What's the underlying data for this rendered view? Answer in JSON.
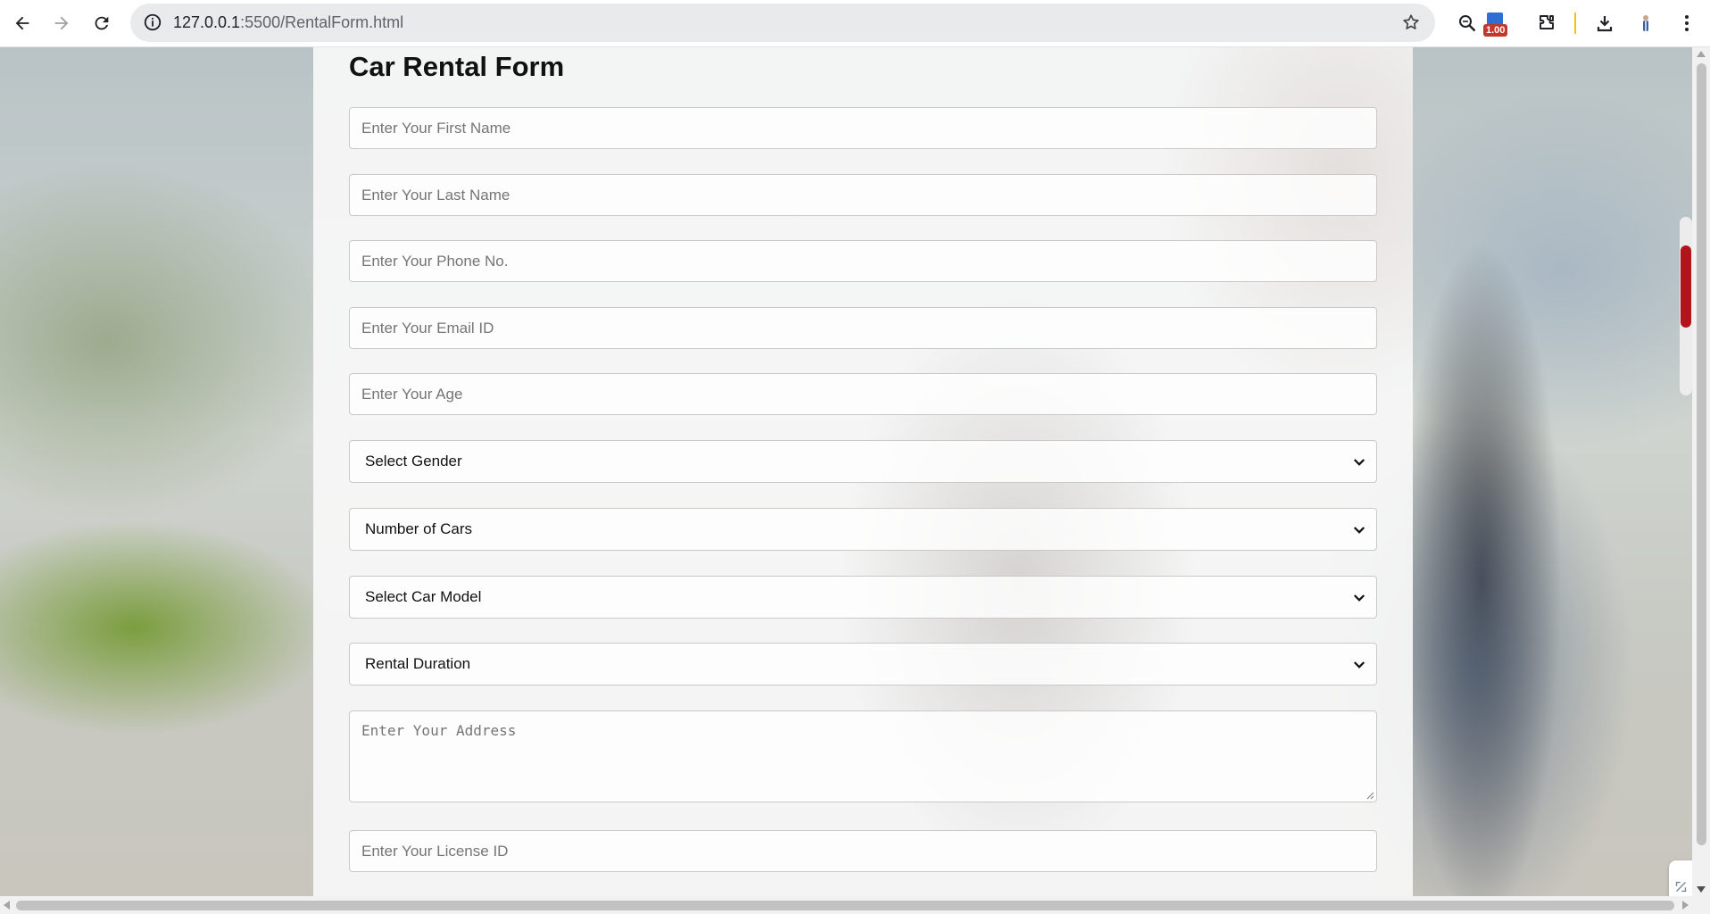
{
  "browser": {
    "url": "127.0.0.1:5500/RentalForm.html",
    "url_host": "127.0.0.1",
    "url_rest": ":5500/RentalForm.html",
    "extension_badge": "1.00",
    "icons": [
      "back-icon",
      "forward-icon",
      "reload-icon",
      "site-info-icon",
      "bookmark-star-icon",
      "zoom-icon",
      "extension-badge-icon",
      "puzzle-icon",
      "download-icon",
      "profile-icon",
      "menu-icon"
    ]
  },
  "form": {
    "title": "Car Rental Form",
    "first_name_placeholder": "Enter Your First Name",
    "last_name_placeholder": "Enter Your Last Name",
    "phone_placeholder": "Enter Your Phone No.",
    "email_placeholder": "Enter Your Email ID",
    "age_placeholder": "Enter Your Age",
    "gender_selected": "Select Gender",
    "cars_selected": "Number of Cars",
    "model_selected": "Select Car Model",
    "duration_selected": "Rental Duration",
    "address_placeholder": "Enter Your Address",
    "license_placeholder": "Enter Your License ID"
  },
  "colors": {
    "panel_background": "#f8f8f7",
    "field_border": "#c9c9c9",
    "accent_red": "#b3141b"
  }
}
